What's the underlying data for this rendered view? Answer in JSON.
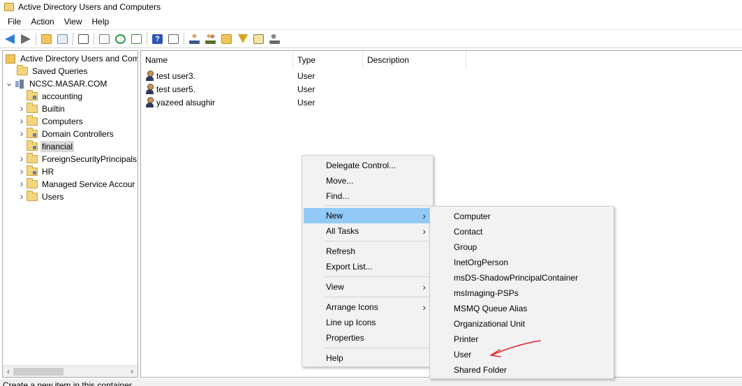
{
  "window": {
    "title": "Active Directory Users and Computers"
  },
  "menubar": {
    "items": [
      "File",
      "Action",
      "View",
      "Help"
    ]
  },
  "toolbar": {
    "icons": [
      "back-arrow-icon",
      "forward-arrow-icon",
      "up-folder-icon",
      "show-hide-tree-icon",
      "clipboard-icon",
      "properties-icon",
      "refresh-icon",
      "export-list-icon",
      "help-icon",
      "console-tree-icon",
      "new-user-icon",
      "new-group-icon",
      "new-ou-icon",
      "filter-icon",
      "find-icon",
      "delegate-icon"
    ]
  },
  "tree": {
    "root": "Active Directory Users and Com",
    "saved_queries": "Saved Queries",
    "domain": "NCSC.MASAR.COM",
    "items": [
      {
        "label": "accounting",
        "expandable": false,
        "type": "ou"
      },
      {
        "label": "Builtin",
        "expandable": true,
        "type": "folder"
      },
      {
        "label": "Computers",
        "expandable": true,
        "type": "folder"
      },
      {
        "label": "Domain Controllers",
        "expandable": true,
        "type": "ou"
      },
      {
        "label": "financial",
        "expandable": false,
        "type": "ou",
        "selected": true
      },
      {
        "label": "ForeignSecurityPrincipals",
        "expandable": true,
        "type": "folder"
      },
      {
        "label": "HR",
        "expandable": true,
        "type": "ou"
      },
      {
        "label": "Managed Service Accour",
        "expandable": true,
        "type": "folder"
      },
      {
        "label": "Users",
        "expandable": true,
        "type": "folder"
      }
    ]
  },
  "list": {
    "columns": [
      "Name",
      "Type",
      "Description"
    ],
    "rows": [
      {
        "name": "test user3.",
        "type": "User",
        "description": ""
      },
      {
        "name": "test user5.",
        "type": "User",
        "description": ""
      },
      {
        "name": "yazeed alsughir",
        "type": "User",
        "description": ""
      }
    ]
  },
  "context_menu": {
    "items": [
      "Delegate Control...",
      "Move...",
      "Find...",
      "New",
      "All Tasks",
      "Refresh",
      "Export List...",
      "View",
      "Arrange Icons",
      "Line up Icons",
      "Properties",
      "Help"
    ],
    "highlighted": "New"
  },
  "submenu": {
    "items": [
      "Computer",
      "Contact",
      "Group",
      "InetOrgPerson",
      "msDS-ShadowPrincipalContainer",
      "msImaging-PSPs",
      "MSMQ Queue Alias",
      "Organizational Unit",
      "Printer",
      "User",
      "Shared Folder"
    ]
  },
  "annotation": {
    "color": "#e0282e"
  },
  "statusbar": {
    "text": "Create a new item in this container."
  }
}
